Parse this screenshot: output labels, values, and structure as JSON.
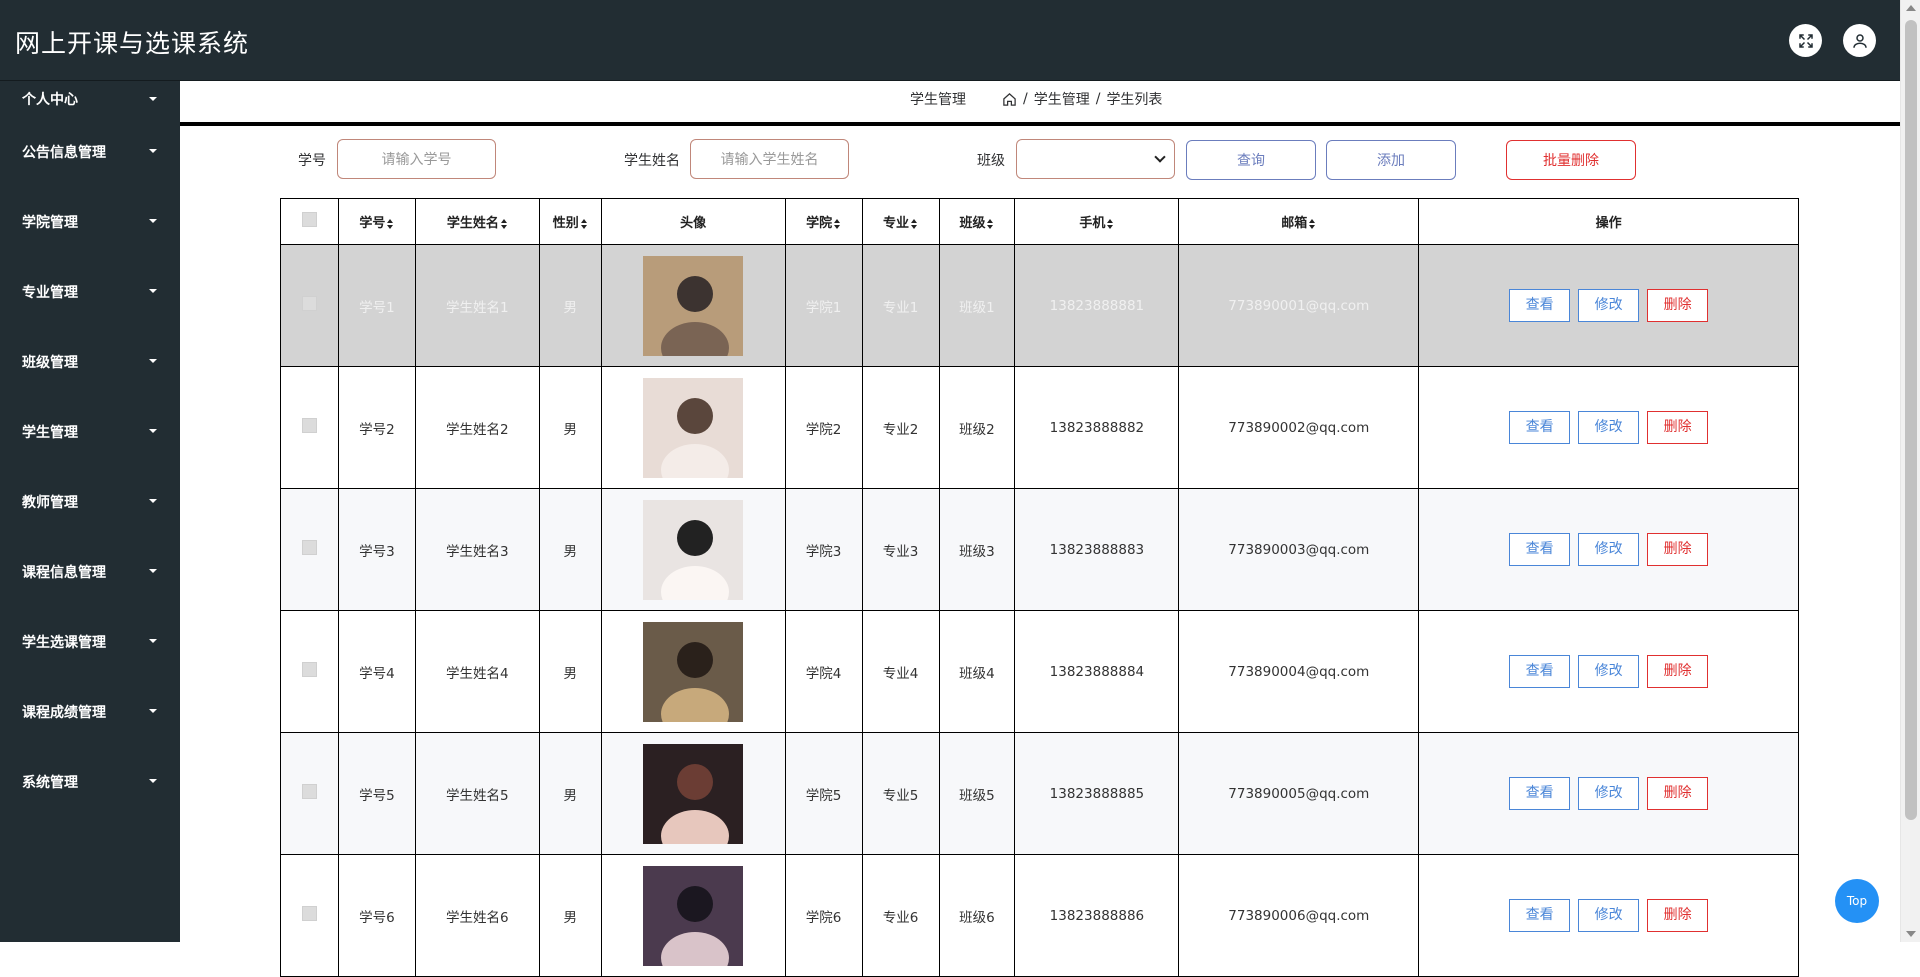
{
  "app": {
    "title": "网上开课与选课系统"
  },
  "sidebar": {
    "items": [
      {
        "label": "个人中心"
      },
      {
        "label": "公告信息管理"
      },
      {
        "label": "学院管理"
      },
      {
        "label": "专业管理"
      },
      {
        "label": "班级管理"
      },
      {
        "label": "学生管理"
      },
      {
        "label": "教师管理"
      },
      {
        "label": "课程信息管理"
      },
      {
        "label": "学生选课管理"
      },
      {
        "label": "课程成绩管理"
      },
      {
        "label": "系统管理"
      }
    ]
  },
  "breadcrumb": {
    "title": "学生管理",
    "items": [
      "学生管理",
      "学生列表"
    ],
    "separator": "/"
  },
  "search": {
    "id_label": "学号",
    "id_placeholder": "请输入学号",
    "name_label": "学生姓名",
    "name_placeholder": "请输入学生姓名",
    "class_label": "班级",
    "class_value": "",
    "query_label": "查询",
    "add_label": "添加",
    "batch_delete_label": "批量删除"
  },
  "table": {
    "headers": [
      "学号",
      "学生姓名",
      "性别",
      "头像",
      "学院",
      "专业",
      "班级",
      "手机",
      "邮箱",
      "操作"
    ],
    "rows": [
      {
        "id": "学号1",
        "name": "学生姓名1",
        "gender": "男",
        "college": "学院1",
        "major": "专业1",
        "class": "班级1",
        "phone": "13823888881",
        "email": "773890001@qq.com"
      },
      {
        "id": "学号2",
        "name": "学生姓名2",
        "gender": "男",
        "college": "学院2",
        "major": "专业2",
        "class": "班级2",
        "phone": "13823888882",
        "email": "773890002@qq.com"
      },
      {
        "id": "学号3",
        "name": "学生姓名3",
        "gender": "男",
        "college": "学院3",
        "major": "专业3",
        "class": "班级3",
        "phone": "13823888883",
        "email": "773890003@qq.com"
      },
      {
        "id": "学号4",
        "name": "学生姓名4",
        "gender": "男",
        "college": "学院4",
        "major": "专业4",
        "class": "班级4",
        "phone": "13823888884",
        "email": "773890004@qq.com"
      },
      {
        "id": "学号5",
        "name": "学生姓名5",
        "gender": "男",
        "college": "学院5",
        "major": "专业5",
        "class": "班级5",
        "phone": "13823888885",
        "email": "773890005@qq.com"
      },
      {
        "id": "学号6",
        "name": "学生姓名6",
        "gender": "男",
        "college": "学院6",
        "major": "专业6",
        "class": "班级6",
        "phone": "13823888886",
        "email": "773890006@qq.com"
      }
    ],
    "actions": {
      "view": "查看",
      "edit": "修改",
      "delete": "删除"
    }
  },
  "float_button": {
    "label": "Top"
  },
  "colors": {
    "header_bg": "#222d33",
    "sidebar_bg": "#222d33",
    "accent_blue": "#4a86d8",
    "danger_red": "#e03030",
    "top_button": "#2491f5"
  }
}
